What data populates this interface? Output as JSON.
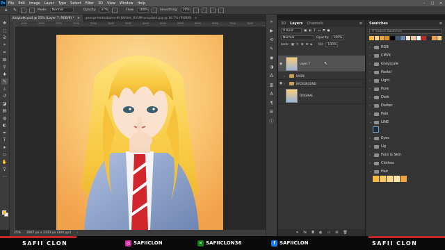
{
  "menu": {
    "app_icon": "Ps",
    "items": [
      "File",
      "Edit",
      "Image",
      "Layer",
      "Type",
      "Select",
      "Filter",
      "3D",
      "View",
      "Window",
      "Help"
    ]
  },
  "options_bar": {
    "mode_label": "Mode:",
    "mode_value": "Normal",
    "opacity_label": "Opacity:",
    "opacity_value": "37%",
    "flow_label": "Flow:",
    "flow_value": "100%",
    "smoothing_label": "Smoothing:",
    "smoothing_value": "10%"
  },
  "document_tabs": [
    {
      "label": "Katytoko.psd @ 25% (Layer 7, RGB/8) *",
      "active": true
    },
    {
      "label": "george-kedoaborsa-8i-JW/dds_KVUM-unsplash.jpg @ 16.7% (RGB/8)",
      "active": false
    }
  ],
  "ruler": {
    "ticks": [
      "1000",
      "1500",
      "2000",
      "2500",
      "3000",
      "3500",
      "4000",
      "4500",
      "5000",
      "5500",
      "6000",
      "6500",
      "7000",
      "7500"
    ]
  },
  "status_bar": {
    "zoom": "25%",
    "doc_size": "2867 px x 3333 px (300 ppi)"
  },
  "layers_panel": {
    "tabs": [
      "3D",
      "Layers",
      "Channels"
    ],
    "active_tab": "Layers",
    "filter_kind": "Kind",
    "blend_mode": "Normal",
    "opacity_label": "Opacity:",
    "opacity_value": "100%",
    "lock_label": "Lock:",
    "fill_label": "Fill:",
    "fill_value": "100%",
    "layers": [
      {
        "name": "Layer 7",
        "type": "image",
        "visible": true,
        "selected": true
      },
      {
        "name": "KAORI",
        "type": "group",
        "visible": false,
        "selected": false
      },
      {
        "name": "BACKGROUND",
        "type": "group",
        "visible": true,
        "selected": false
      },
      {
        "name": "ORIGINAL",
        "type": "image",
        "visible": false,
        "selected": false
      }
    ],
    "footer_icons": [
      "link-icon",
      "fx-icon",
      "mask-icon",
      "adjustment-icon",
      "new-group-icon",
      "new-layer-icon",
      "trash-icon"
    ]
  },
  "swatches_panel": {
    "tab": "Swatches",
    "search_placeholder": "Search Swatches",
    "recent_colors": [
      "#f5b840",
      "#f7d088",
      "#eea544",
      "#d88f2a",
      "#000000",
      "#3e5877",
      "#6b88b0",
      "#f2e6cf",
      "#e8c9a4",
      "#ffffff",
      "#c42a2a",
      "#2b2b2b",
      "#f0a04a",
      "#ffd27a"
    ],
    "groups": [
      {
        "name": "RGB",
        "expanded": false
      },
      {
        "name": "CMYK",
        "expanded": false
      },
      {
        "name": "Grayscale",
        "expanded": false
      },
      {
        "name": "Pastel",
        "expanded": false
      },
      {
        "name": "Light",
        "expanded": false
      },
      {
        "name": "Pure",
        "expanded": false
      },
      {
        "name": "Dark",
        "expanded": false
      },
      {
        "name": "Darker",
        "expanded": false
      },
      {
        "name": "Pale",
        "expanded": false
      },
      {
        "name": "LINE",
        "expanded": true,
        "colors": [
          "#1a2b3a"
        ]
      },
      {
        "name": "Eyes",
        "expanded": false
      },
      {
        "name": "Lip",
        "expanded": false
      },
      {
        "name": "Face & Skin",
        "expanded": false
      },
      {
        "name": "Clothes",
        "expanded": false
      },
      {
        "name": "Hair",
        "expanded": true,
        "colors": [
          "#f5b840",
          "#f7c85e",
          "#fad885",
          "#fde4a8",
          "#eea544"
        ]
      }
    ]
  },
  "banner": {
    "left_text": "SAFII CLON",
    "instagram": "SAFIICLON",
    "xbox": "SAFIICLON36",
    "facebook": "SAFIICLON",
    "right_text": "SAFII CLON"
  },
  "colors": {
    "foreground": "#f5b840",
    "background": "#ffffff",
    "accent": "#c62828"
  }
}
